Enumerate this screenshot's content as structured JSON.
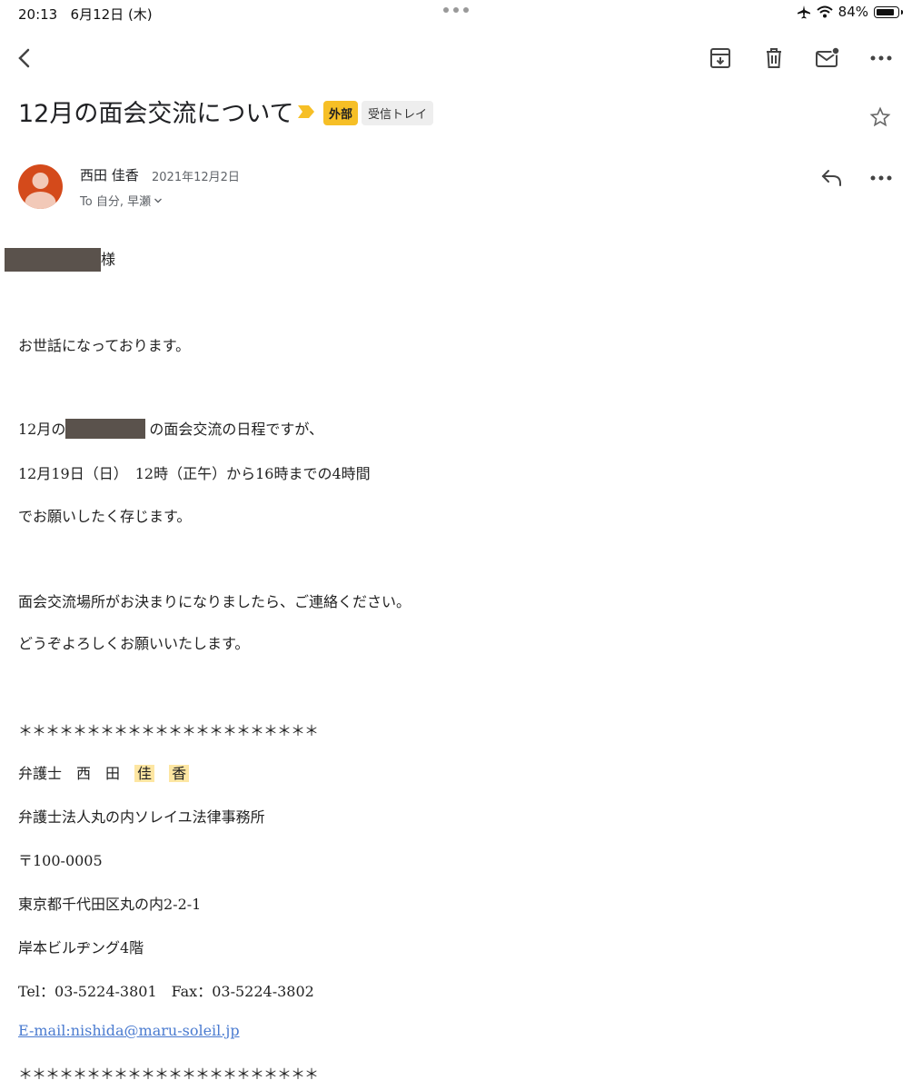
{
  "status_bar": {
    "time": "20:13",
    "date": "6月12日 (木)",
    "battery": "84%",
    "battery_level": 0.84
  },
  "toolbar": {
    "icons": [
      "back-icon",
      "archive-icon",
      "trash-icon",
      "mark-unread-icon",
      "more-icon"
    ]
  },
  "email": {
    "subject": "12月の面会交流について",
    "labels": {
      "external": "外部",
      "inbox": "受信トレイ"
    },
    "sender": {
      "name": "西田 佳香",
      "date": "2021年12月2日"
    },
    "recipients": "To 自分, 早瀬"
  },
  "body": {
    "salutation_suffix": "様",
    "greeting": "お世話になっております。",
    "line1_prefix": "12月の",
    "line1_suffix": "の面会交流の日程ですが、",
    "line2": "12月19日（日）　12時（正午）から16時までの4時間",
    "line3": "でお願いしたく存じます。",
    "line4": "面会交流場所がお決まりになりましたら、ご連絡ください。",
    "line5": "どうぞよろしくお願いいたします。"
  },
  "signature": {
    "separator": "＊＊＊＊＊＊＊＊＊＊＊＊＊＊＊＊＊＊＊＊＊＊",
    "title_name": "弁護士　西　田",
    "highlight1": "佳",
    "highlight2": "香",
    "firm": "弁護士法人丸の内ソレイユ法律事務所",
    "postal": "〒100-0005",
    "address1": "東京都千代田区丸の内2-2-1",
    "address2": "岸本ビルヂング4階",
    "phone": "Tel：03-5224-3801　Fax：03-5224-3802",
    "email": "E-mail:nishida@maru-soleil.jp"
  },
  "colors": {
    "label_external_bg": "#f6bf26",
    "avatar_bg": "#d44a1b",
    "link": "#4a7bd0",
    "highlight": "#fde6a2"
  }
}
